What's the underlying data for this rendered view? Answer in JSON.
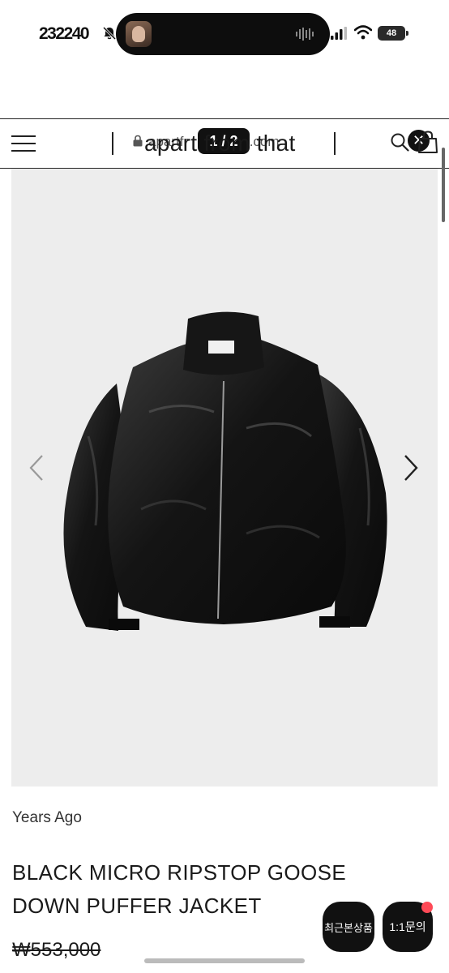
{
  "status_bar": {
    "time": "232240",
    "battery": "48",
    "icons": [
      "mute-icon",
      "signal-icon",
      "wifi-icon",
      "battery-icon"
    ]
  },
  "browser": {
    "url": "apartfr        store.com",
    "page_counter": "1 / 2",
    "close_label": "✕"
  },
  "header": {
    "brand": "apart from that",
    "icons": [
      "menu-icon",
      "search-icon",
      "bag-icon"
    ]
  },
  "product": {
    "label": "Years Ago",
    "title": "BLACK MICRO RIPSTOP GOOSE DOWN PUFFER JACKET",
    "price": "₩553,000"
  },
  "floating_buttons": {
    "recent_label": "최근본상품",
    "inquiry_label": "1:1문의"
  },
  "colors": {
    "background": "#ffffff",
    "image_background": "#ededed",
    "dark": "#111111",
    "notification": "#ff4a57"
  }
}
